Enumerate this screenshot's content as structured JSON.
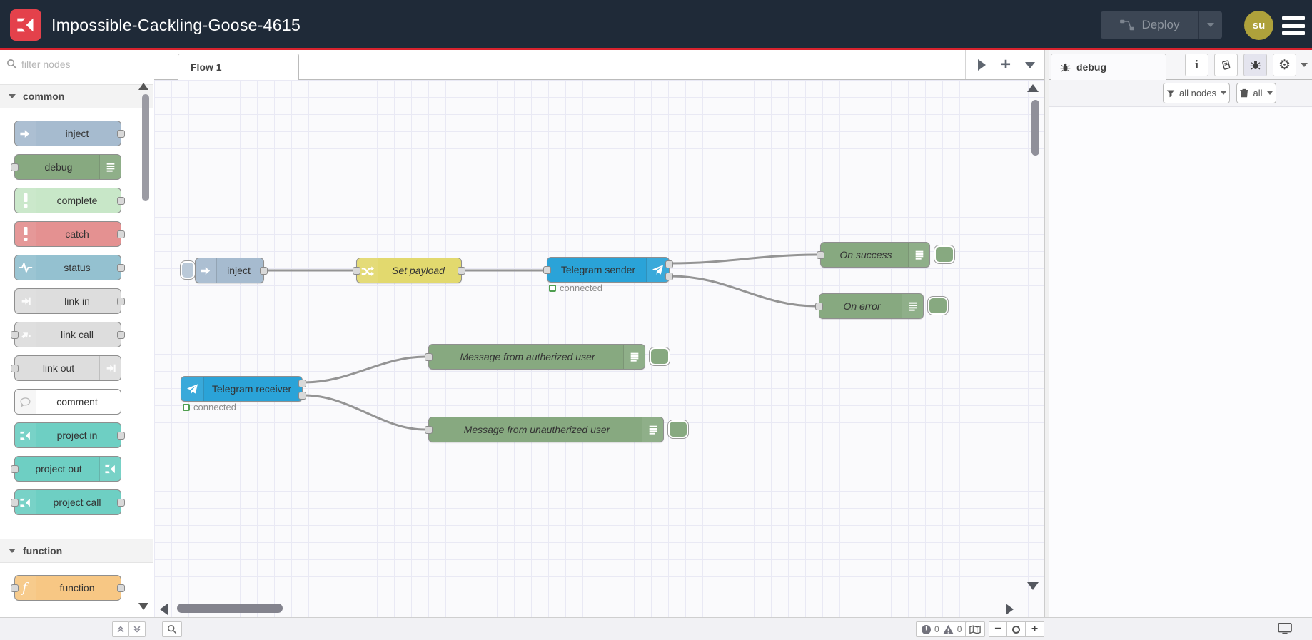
{
  "header": {
    "title": "Impossible-Cackling-Goose-4615",
    "deploy_label": "Deploy",
    "avatar_initials": "su"
  },
  "palette": {
    "search_placeholder": "filter nodes",
    "sections": [
      {
        "label": "common",
        "items": [
          {
            "label": "inject"
          },
          {
            "label": "debug"
          },
          {
            "label": "complete"
          },
          {
            "label": "catch"
          },
          {
            "label": "status"
          },
          {
            "label": "link in"
          },
          {
            "label": "link call"
          },
          {
            "label": "link out"
          },
          {
            "label": "comment"
          },
          {
            "label": "project in"
          },
          {
            "label": "project out"
          },
          {
            "label": "project call"
          }
        ]
      },
      {
        "label": "function",
        "items": [
          {
            "label": "function"
          }
        ]
      }
    ]
  },
  "workspace": {
    "tab_label": "Flow 1",
    "nodes": {
      "inject": {
        "label": "inject"
      },
      "set_payload": {
        "label": "Set payload"
      },
      "telegram_sender": {
        "label": "Telegram sender",
        "status": "connected"
      },
      "on_success": {
        "label": "On success"
      },
      "on_error": {
        "label": "On error"
      },
      "telegram_receiver": {
        "label": "Telegram receiver",
        "status": "connected"
      },
      "msg_authorized": {
        "label": "Message from autherized user"
      },
      "msg_unauthorized": {
        "label": "Message from unautherized user"
      }
    },
    "footer": {
      "error_count": "0",
      "warning_count": "0"
    }
  },
  "sidebar": {
    "tab_label": "debug",
    "filter_button": "all nodes",
    "clear_button": "all"
  },
  "colors": {
    "header_bg": "#1f2a38",
    "accent_red": "#d8232e",
    "logo_red": "#e4414b",
    "avatar_bg": "#aea13b",
    "node_inject": "#a6bbcf",
    "node_debug": "#87a980",
    "node_complete": "#c8e7c8",
    "node_catch": "#e49191",
    "node_status": "#94c1d0",
    "node_link": "#dddddd",
    "node_comment": "#ffffff",
    "node_project": "#6ecfc3",
    "node_function": "#f7c784",
    "node_change": "#e2d96e",
    "node_telegram": "#2aa3d8",
    "wire": "#949494",
    "status_green": "#4f9e4f"
  }
}
